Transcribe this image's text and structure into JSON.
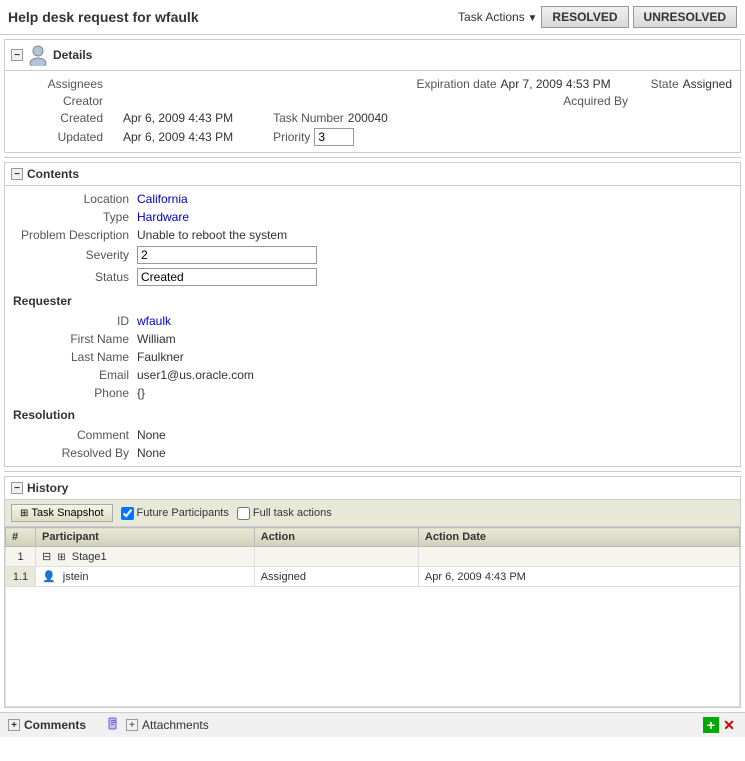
{
  "header": {
    "title": "Help desk request for wfaulk",
    "task_actions_label": "Task Actions",
    "btn_resolved": "RESOLVED",
    "btn_unresolved": "UNRESOLVED"
  },
  "details": {
    "section_label": "Details",
    "assignees_label": "Assignees",
    "creator_label": "Creator",
    "created_label": "Created",
    "updated_label": "Updated",
    "expiration_date_label": "Expiration date",
    "acquired_by_label": "Acquired By",
    "task_number_label": "Task Number",
    "priority_label": "Priority",
    "state_label": "State",
    "expiration_date_value": "Apr 7, 2009 4:53 PM",
    "acquired_by_value": "",
    "task_number_value": "200040",
    "priority_value": "3",
    "state_value": "Assigned",
    "created_value": "Apr 6, 2009 4:43 PM",
    "updated_value": "Apr 6, 2009 4:43 PM"
  },
  "contents": {
    "section_label": "Contents",
    "location_label": "Location",
    "location_value": "California",
    "type_label": "Type",
    "type_value": "Hardware",
    "problem_description_label": "Problem Description",
    "problem_description_value": "Unable to reboot the system",
    "severity_label": "Severity",
    "severity_value": "2",
    "status_label": "Status",
    "status_value": "Created",
    "requester_label": "Requester",
    "id_label": "ID",
    "id_value": "wfaulk",
    "first_name_label": "First Name",
    "first_name_value": "William",
    "last_name_label": "Last Name",
    "last_name_value": "Faulkner",
    "email_label": "Email",
    "email_value": "user1@us.oracle.com",
    "phone_label": "Phone",
    "phone_value": "{}",
    "resolution_label": "Resolution",
    "comment_label": "Comment",
    "comment_value": "None",
    "resolved_by_label": "Resolved By",
    "resolved_by_value": "None"
  },
  "history": {
    "section_label": "History",
    "btn_task_snapshot": "Task Snapshot",
    "chk_future_participants": "Future Participants",
    "chk_full_task_actions": "Full task actions",
    "table_headers": [
      "#",
      "Participant",
      "Action",
      "Action Date"
    ],
    "rows": [
      {
        "num": "1",
        "participant": "Stage1",
        "action": "",
        "action_date": "",
        "is_stage": true
      },
      {
        "num": "1.1",
        "participant": "jstein",
        "action": "Assigned",
        "action_date": "Apr 6, 2009 4:43 PM",
        "is_stage": false
      }
    ]
  },
  "bottom": {
    "comments_label": "Comments",
    "attachments_label": "Attachments"
  },
  "icons": {
    "collapse_minus": "−",
    "collapse_plus": "+",
    "user_svg": "person",
    "stage_icon": "▦",
    "participant_icon": "👤"
  }
}
